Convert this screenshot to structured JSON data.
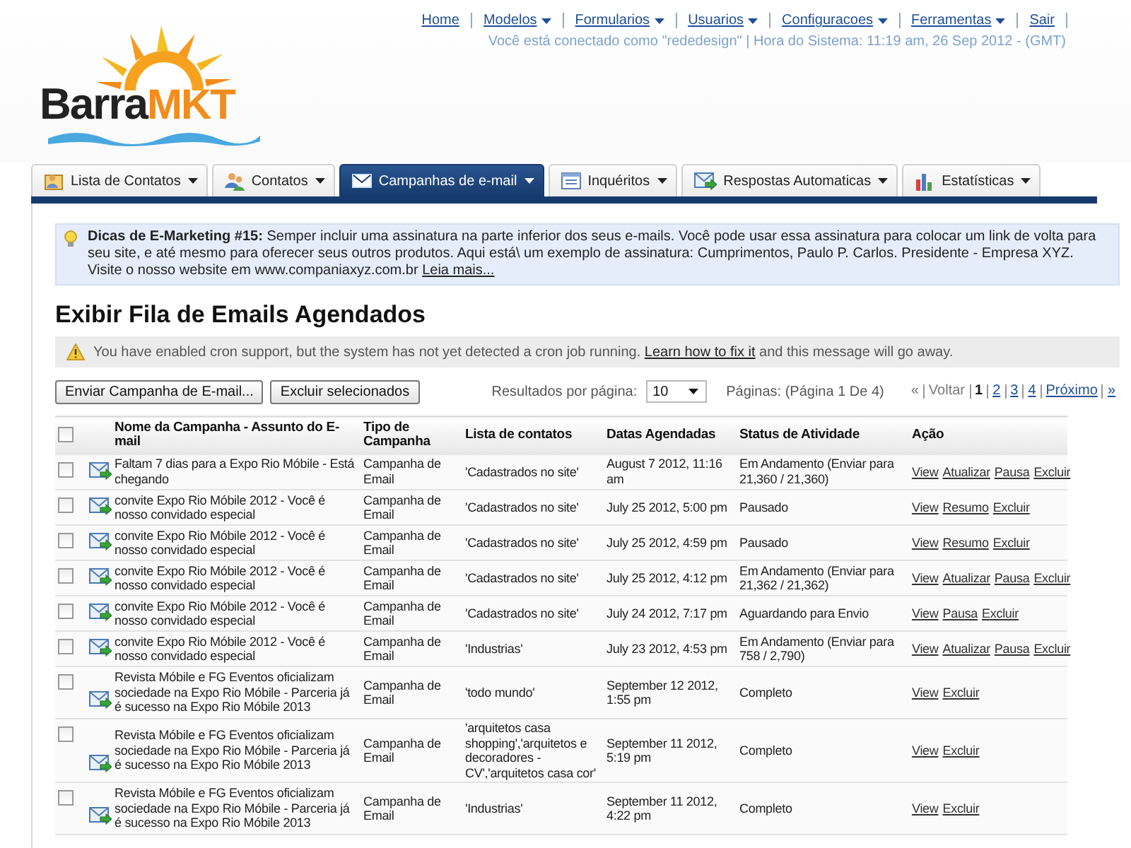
{
  "nav": {
    "links": [
      {
        "label": "Home",
        "dropdown": false
      },
      {
        "label": "Modelos",
        "dropdown": true
      },
      {
        "label": "Formularios",
        "dropdown": true
      },
      {
        "label": "Usuarios",
        "dropdown": true
      },
      {
        "label": "Configuracoes",
        "dropdown": true
      },
      {
        "label": "Ferramentas",
        "dropdown": true
      },
      {
        "label": "Sair",
        "dropdown": false
      }
    ],
    "status": "Você está conectado como \"rededesign\" | Hora do Sistema: 11:19 am, 26 Sep 2012 - (GMT)"
  },
  "logo": {
    "part_1": "Barra",
    "part_2": "MKT"
  },
  "tabs": [
    {
      "label": "Lista de Contatos",
      "selected": false
    },
    {
      "label": "Contatos",
      "selected": false
    },
    {
      "label": "Campanhas de e-mail",
      "selected": true
    },
    {
      "label": "Inquéritos",
      "selected": false
    },
    {
      "label": "Respostas Automaticas",
      "selected": false
    },
    {
      "label": "Estatísticas",
      "selected": false
    }
  ],
  "tip": {
    "text": "**Dicas de E-Marketing #15:** Semper incluir uma assinatura na parte inferior dos seus e-mails. Você pode usar essa assinatura para colocar um link de volta para seu site, e até mesmo para oferecer seus outros produtos. Aqui está\\ um exemplo de assinatura: Cumprimentos, Paulo P. Carlos. Presidente - Empresa XYZ. Visite o nosso website em www.companiaxyz.com.br",
    "link": "Leia mais..."
  },
  "heading": "Exibir Fila de Emails Agendados",
  "warning": {
    "text_before": "You have enabled cron support, but the system has not yet detected a cron job running.",
    "link": "Learn how to fix it",
    "text_after": "and this message will go away."
  },
  "toolbar": {
    "buttons": [
      "Enviar Campanha de E-mail...",
      "Excluir selecionados"
    ],
    "per_page_label": "Resultados por página:",
    "per_page": "10",
    "pages_label": "Páginas: (Página 1 De 4)",
    "pages": [
      {
        "label": "«",
        "disabled": true,
        "selected": false
      },
      {
        "label": "Voltar",
        "disabled": true,
        "selected": false
      },
      {
        "label": "1",
        "disabled": false,
        "selected": true
      },
      {
        "label": "2",
        "disabled": false,
        "selected": false
      },
      {
        "label": "3",
        "disabled": false,
        "selected": false
      },
      {
        "label": "4",
        "disabled": false,
        "selected": false
      },
      {
        "label": "Próximo",
        "disabled": false,
        "selected": false
      },
      {
        "label": "»",
        "disabled": false,
        "selected": false
      }
    ]
  },
  "table": {
    "all_checked": false,
    "columns": [
      "Nome da Campanha - Assunto do E-mail",
      "Tipo de Campanha",
      "Lista de contatos",
      "Datas Agendadas",
      "Status de Atividade",
      "Ação"
    ],
    "rows": [
      {
        "checked": false,
        "name": "Faltam 7 dias para a Expo Rio Móbile - Está chegando",
        "type": "Campanha de Email",
        "list": "'Cadastrados no site'",
        "date": "August 7 2012, 11:16 am",
        "status": "Em Andamento (Enviar para 21,360 / 21,360)",
        "actions": [
          "View",
          "Atualizar",
          "Pausa",
          "Excluir"
        ]
      },
      {
        "checked": false,
        "name": "convite Expo Rio Móbile 2012 - Você é nosso convidado especial",
        "type": "Campanha de Email",
        "list": "'Cadastrados no site'",
        "date": "July 25 2012, 5:00 pm",
        "status": "Pausado",
        "actions": [
          "View",
          "Resumo",
          "Excluir"
        ]
      },
      {
        "checked": false,
        "name": "convite Expo Rio Móbile 2012 - Você é nosso convidado especial",
        "type": "Campanha de Email",
        "list": "'Cadastrados no site'",
        "date": "July 25 2012, 4:59 pm",
        "status": "Pausado",
        "actions": [
          "View",
          "Resumo",
          "Excluir"
        ]
      },
      {
        "checked": false,
        "name": "convite Expo Rio Móbile 2012 - Você é nosso convidado especial",
        "type": "Campanha de Email",
        "list": "'Cadastrados no site'",
        "date": "July 25 2012, 4:12 pm",
        "status": "Em Andamento (Enviar para 21,362 / 21,362)",
        "actions": [
          "View",
          "Atualizar",
          "Pausa",
          "Excluir"
        ]
      },
      {
        "checked": false,
        "name": "convite Expo Rio Móbile 2012 - Você é nosso convidado especial",
        "type": "Campanha de Email",
        "list": "'Cadastrados no site'",
        "date": "July 24 2012, 7:17 pm",
        "status": "Aguardando para Envio",
        "actions": [
          "View",
          "Pausa",
          "Excluir"
        ]
      },
      {
        "checked": false,
        "name": "convite Expo Rio Móbile 2012 - Você é nosso convidado especial",
        "type": "Campanha de Email",
        "list": "'Industrias'",
        "date": "July 23 2012, 4:53 pm",
        "status": "Em Andamento (Enviar para 758 / 2,790)",
        "actions": [
          "View",
          "Atualizar",
          "Pausa",
          "Excluir"
        ]
      },
      {
        "checked": false,
        "name": "Revista Móbile e FG Eventos oficializam sociedade na Expo Rio Móbile - Parceria já é sucesso na Expo Rio Móbile 2013",
        "type": "Campanha de Email",
        "list": "'todo mundo'",
        "date": "September 12 2012, 1:55 pm",
        "status": "Completo",
        "actions": [
          "View",
          "Excluir"
        ]
      },
      {
        "checked": false,
        "name": "Revista Móbile e FG Eventos oficializam sociedade na Expo Rio Móbile - Parceria já é sucesso na Expo Rio Móbile 2013",
        "type": "Campanha de Email",
        "list": "'arquitetos casa shopping','arquitetos e decoradores - CV','arquitetos casa cor'",
        "date": "September 11 2012, 5:19 pm",
        "status": "Completo",
        "actions": [
          "View",
          "Excluir"
        ]
      },
      {
        "checked": false,
        "name": "Revista Móbile e FG Eventos oficializam sociedade na Expo Rio Móbile - Parceria já é sucesso na Expo Rio Móbile 2013",
        "type": "Campanha de Email",
        "list": "'Industrias'",
        "date": "September 11 2012, 4:22 pm",
        "status": "Completo",
        "actions": [
          "View",
          "Excluir"
        ]
      }
    ]
  }
}
